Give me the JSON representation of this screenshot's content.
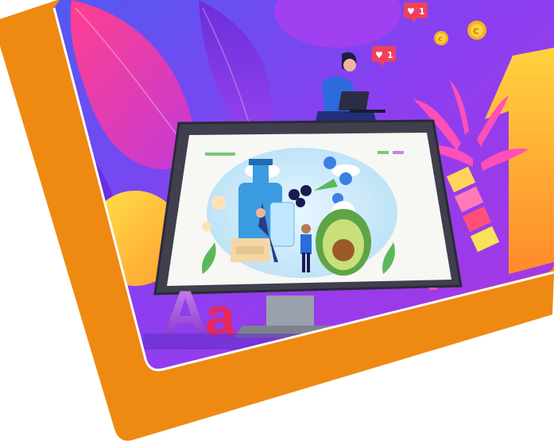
{
  "illustration": {
    "theme": "digital-marketing-hero-banner",
    "colors": {
      "frame_orange": "#ee8a12",
      "scene_background": "#7a3ff0",
      "monitor_body": "#3f3f4d",
      "screen_background": "#f7f7f4",
      "like_badge": "#f0405c",
      "coin": "#f5b31e"
    },
    "notifications": [
      {
        "icon": "heart-icon",
        "count": "1"
      },
      {
        "icon": "heart-icon",
        "count": "1"
      }
    ],
    "coins": [
      {
        "symbol": "c"
      },
      {
        "symbol": "c"
      }
    ],
    "typography_sample": "Aa"
  }
}
